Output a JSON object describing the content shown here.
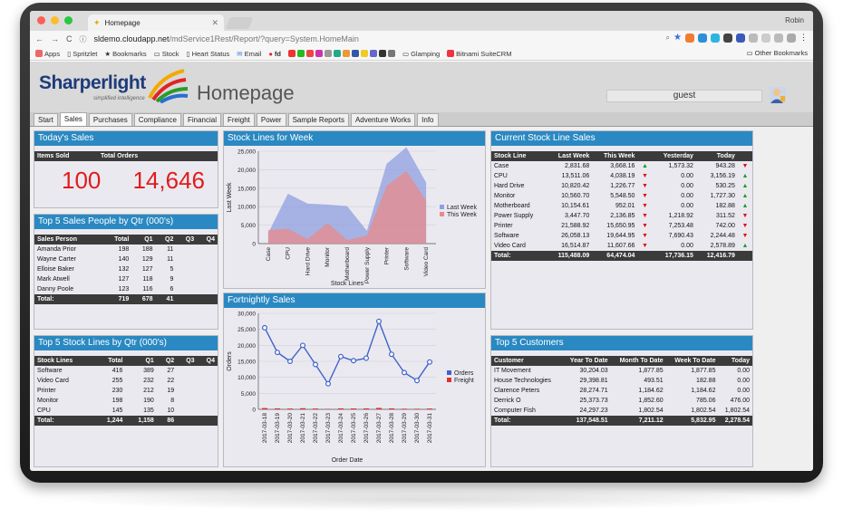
{
  "browser": {
    "tab_title": "Homepage",
    "profile": "Robin",
    "url_host": "sldemo.cloudapp.net",
    "url_path": "/mdService1Rest/Report/?query=System.HomeMain",
    "bookmarks": [
      "Apps",
      "Spritzlet",
      "Bookmarks",
      "Stock",
      "Heart Status",
      "Email",
      "fd",
      "Glamping",
      "Bitnami SuiteCRM"
    ],
    "other_bookmarks": "Other Bookmarks"
  },
  "app": {
    "logo": "Sharperlight",
    "logo_tagline": "simplified intelligence",
    "title": "Homepage",
    "user": "guest",
    "tabs": [
      "Start",
      "Sales",
      "Purchases",
      "Compliance",
      "Financial",
      "Freight",
      "Power",
      "Sample Reports",
      "Adventure Works",
      "Info"
    ],
    "active_tab": "Sales"
  },
  "todays_sales": {
    "title": "Today's Sales",
    "headers": [
      "Items Sold",
      "Total Orders"
    ],
    "items_sold": "100",
    "total_orders": "14,646"
  },
  "top5_people": {
    "title": "Top 5 Sales People by Qtr (000's)",
    "headers": [
      "Sales Person",
      "Total",
      "Q1",
      "Q2",
      "Q3",
      "Q4"
    ],
    "rows": [
      [
        "Amanda Prior",
        "198",
        "188",
        "11",
        "",
        ""
      ],
      [
        "Wayne Carter",
        "140",
        "129",
        "11",
        "",
        ""
      ],
      [
        "Elloise Baker",
        "132",
        "127",
        "5",
        "",
        ""
      ],
      [
        "Mark Atwell",
        "127",
        "118",
        "9",
        "",
        ""
      ],
      [
        "Danny Poole",
        "123",
        "116",
        "6",
        "",
        ""
      ]
    ],
    "total": [
      "Total:",
      "719",
      "678",
      "41",
      "",
      ""
    ]
  },
  "top5_stock": {
    "title": "Top 5 Stock Lines by Qtr (000's)",
    "headers": [
      "Stock Lines",
      "Total",
      "Q1",
      "Q2",
      "Q3",
      "Q4"
    ],
    "rows": [
      [
        "Software",
        "416",
        "389",
        "27",
        "",
        ""
      ],
      [
        "Video Card",
        "255",
        "232",
        "22",
        "",
        ""
      ],
      [
        "Printer",
        "230",
        "212",
        "19",
        "",
        ""
      ],
      [
        "Monitor",
        "198",
        "190",
        "8",
        "",
        ""
      ],
      [
        "CPU",
        "145",
        "135",
        "10",
        "",
        ""
      ]
    ],
    "total": [
      "Total:",
      "1,244",
      "1,158",
      "86",
      "",
      ""
    ]
  },
  "stock_week": {
    "title": "Stock Lines for Week"
  },
  "fortnightly": {
    "title": "Fortnightly Sales"
  },
  "current_stock": {
    "title": "Current Stock Line Sales",
    "headers": [
      "Stock Line",
      "Last Week",
      "This Week",
      "",
      "Yesterday",
      "Today",
      ""
    ],
    "rows": [
      [
        "Case",
        "2,831.68",
        "3,668.16",
        "up",
        "1,573.32",
        "943.28",
        "down"
      ],
      [
        "CPU",
        "13,511.06",
        "4,038.19",
        "down",
        "0.00",
        "3,156.19",
        "up"
      ],
      [
        "Hard Drive",
        "10,820.42",
        "1,226.77",
        "down",
        "0.00",
        "530.25",
        "up"
      ],
      [
        "Monitor",
        "10,560.70",
        "5,548.50",
        "down",
        "0.00",
        "1,727.30",
        "up"
      ],
      [
        "Motherboard",
        "10,154.61",
        "952.01",
        "down",
        "0.00",
        "182.88",
        "up"
      ],
      [
        "Power Supply",
        "3,447.70",
        "2,136.85",
        "down",
        "1,218.92",
        "311.52",
        "down"
      ],
      [
        "Printer",
        "21,588.92",
        "15,650.95",
        "down",
        "7,253.48",
        "742.00",
        "down"
      ],
      [
        "Software",
        "26,058.13",
        "19,644.95",
        "down",
        "7,690.43",
        "2,244.48",
        "down"
      ],
      [
        "Video Card",
        "16,514.87",
        "11,607.66",
        "down",
        "0.00",
        "2,578.89",
        "up"
      ]
    ],
    "total": [
      "Total:",
      "115,488.09",
      "64,474.04",
      "",
      "17,736.15",
      "12,416.79",
      ""
    ]
  },
  "top5_customers": {
    "title": "Top 5 Customers",
    "headers": [
      "Customer",
      "Year To Date",
      "Month To Date",
      "Week To Date",
      "Today"
    ],
    "rows": [
      [
        "IT Movement",
        "30,204.03",
        "1,877.85",
        "1,877.85",
        "0.00"
      ],
      [
        "House Technologies",
        "29,398.81",
        "493.51",
        "182.88",
        "0.00"
      ],
      [
        "Clarence Peters",
        "28,274.71",
        "1,184.62",
        "1,184.62",
        "0.00"
      ],
      [
        "Derrick O",
        "25,373.73",
        "1,852.60",
        "785.06",
        "476.00"
      ],
      [
        "Computer Fish",
        "24,297.23",
        "1,802.54",
        "1,802.54",
        "1,802.54"
      ]
    ],
    "total": [
      "Total:",
      "137,548.51",
      "7,211.12",
      "5,832.95",
      "2,278.54"
    ]
  },
  "chart_data": [
    {
      "type": "area",
      "title": "",
      "xlabel": "Stock Lines",
      "ylabel": "Last Week",
      "ylim": [
        0,
        25000
      ],
      "yticks": [
        "0",
        "5,000",
        "10,000",
        "15,000",
        "20,000",
        "25,000"
      ],
      "categories": [
        "Case",
        "CPU",
        "Hard Drive",
        "Monitor",
        "Motherboard",
        "Power Supply",
        "Printer",
        "Software",
        "Video Card"
      ],
      "series": [
        {
          "name": "Last Week",
          "color": "#8f9fe0",
          "values": [
            2832,
            13511,
            10820,
            10561,
            10155,
            3448,
            21589,
            26058,
            16515
          ]
        },
        {
          "name": "This Week",
          "color": "#e88a8a",
          "values": [
            3668,
            4038,
            1227,
            5549,
            952,
            2137,
            15651,
            19645,
            11608
          ]
        }
      ],
      "legend": "right"
    },
    {
      "type": "line",
      "title": "",
      "xlabel": "Order Date",
      "ylabel": "Orders",
      "ylim": [
        0,
        30000
      ],
      "yticks": [
        "0",
        "5,000",
        "10,000",
        "15,000",
        "20,000",
        "25,000",
        "30,000"
      ],
      "categories": [
        "2017-03-18",
        "2017-03-19",
        "2017-03-20",
        "2017-03-21",
        "2017-03-22",
        "2017-03-23",
        "2017-03-24",
        "2017-03-25",
        "2017-03-26",
        "2017-03-27",
        "2017-03-28",
        "2017-03-29",
        "2017-03-30",
        "2017-03-31"
      ],
      "series": [
        {
          "name": "Orders",
          "color": "#3f63c9",
          "values": [
            25500,
            17800,
            15000,
            20000,
            14000,
            8000,
            16500,
            15200,
            16000,
            27500,
            17200,
            11500,
            9000,
            14800
          ]
        },
        {
          "name": "Freight",
          "color": "#e03030",
          "values": [
            400,
            300,
            250,
            350,
            250,
            150,
            300,
            280,
            300,
            450,
            300,
            200,
            180,
            260
          ]
        }
      ],
      "legend": "right"
    }
  ]
}
